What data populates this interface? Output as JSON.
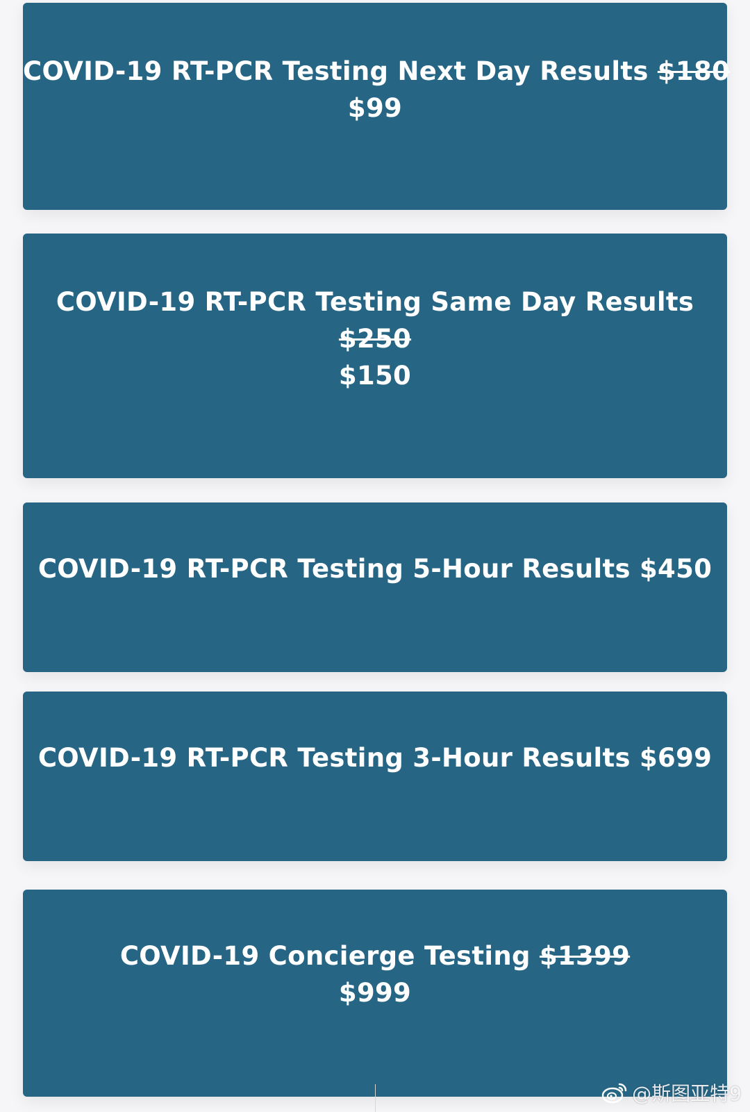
{
  "cards": [
    {
      "title": "COVID-19 RT-PCR Testing Next Day Results",
      "old_price": "$180",
      "price": "$99"
    },
    {
      "title": "COVID-19 RT-PCR Testing Same Day Results",
      "old_price": "$250",
      "price": "$150"
    },
    {
      "title": "COVID-19 RT-PCR Testing 5-Hour Results",
      "price": "$450"
    },
    {
      "title": "COVID-19 RT-PCR Testing 3-Hour Results",
      "price": "$699"
    },
    {
      "title": "COVID-19 Concierge Testing",
      "old_price": "$1399",
      "price": "$999"
    }
  ],
  "watermark": {
    "text": "@斯图亚特9",
    "icon": "weibo-icon"
  },
  "colors": {
    "card_background": "#266584",
    "page_background": "#f6f6f8",
    "text": "#ffffff"
  }
}
